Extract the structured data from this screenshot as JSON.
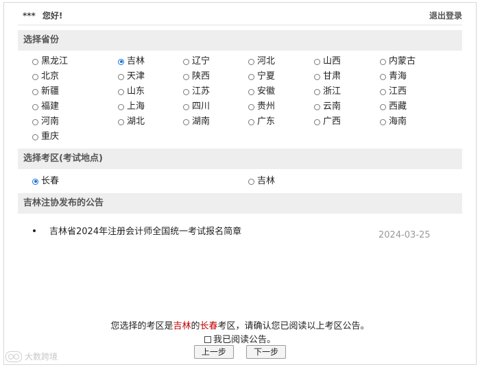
{
  "header": {
    "user": "***",
    "greeting": "您好!",
    "logout": "退出登录"
  },
  "province_section": {
    "title": "选择省份",
    "selected": "吉林",
    "rows": [
      [
        "黑龙江",
        "吉林",
        "辽宁",
        "河北",
        "山西",
        "内蒙古"
      ],
      [
        "北京",
        "天津",
        "陕西",
        "宁夏",
        "甘肃",
        "青海"
      ],
      [
        "新疆",
        "山东",
        "江苏",
        "安徽",
        "浙江",
        "江西"
      ],
      [
        "福建",
        "上海",
        "四川",
        "贵州",
        "云南",
        "西藏"
      ],
      [
        "河南",
        "湖北",
        "湖南",
        "广东",
        "广西",
        "海南"
      ],
      [
        "重庆"
      ]
    ]
  },
  "area_section": {
    "title": "选择考区(考试地点)",
    "selected": "长春",
    "options": [
      "长春",
      "吉林"
    ]
  },
  "notice_section": {
    "title": "吉林注协发布的公告",
    "items": [
      {
        "title": "吉林省2024年注册会计师全国统一考试报名简章",
        "date": "2024-03-25"
      }
    ]
  },
  "confirm": {
    "prefix": "您选择的考区是",
    "province": "吉林",
    "mid": "的",
    "area": "长春",
    "suffix": "考区，请确认您已阅读以上考区公告。",
    "read_label": "我已阅读公告。"
  },
  "buttons": {
    "prev": "上一步",
    "next": "下一步"
  },
  "watermark": "大数跨境",
  "colors": {
    "radio_selected": "#1a6fd8",
    "highlight_red": "#c00000",
    "section_bg": "#eeeeee"
  }
}
